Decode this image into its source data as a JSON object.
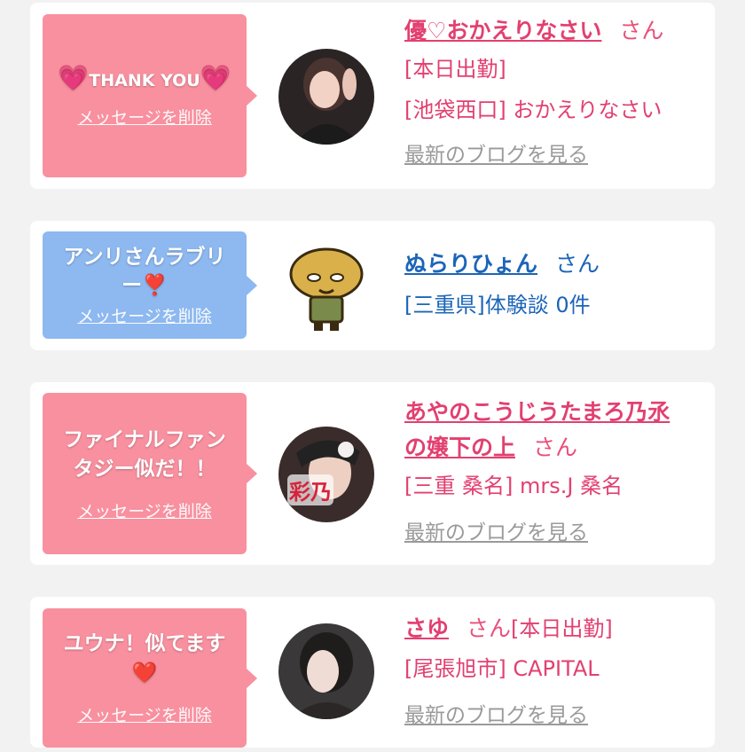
{
  "colors": {
    "pink_bubble": "#f8909f",
    "blue_bubble": "#8db8f0",
    "pink_text": "#e24070",
    "blue_text": "#1c65b8",
    "link_gray": "#9a9a9a"
  },
  "cards": [
    {
      "bubble": {
        "heart_left": "💗",
        "message": "THANK YOU",
        "heart_right": "💗",
        "delete": "メッセージを削除"
      },
      "name": "優♡おかえりなさい",
      "san": "さん",
      "line1": "[本日出勤]",
      "line2": "[池袋西口] おかえりなさい",
      "blog": "最新のブログを見る"
    },
    {
      "bubble": {
        "message_1": "アンリさんラブリ",
        "message_2": "ー❣️",
        "delete": "メッセージを削除"
      },
      "name": "ぬらりひょん",
      "san": "さん",
      "line1": "[三重県]体験談 0件"
    },
    {
      "bubble": {
        "message_1": "ファイナルファン",
        "message_2": "タジー似だ！！",
        "delete": "メッセージを削除"
      },
      "name_1": "あやのこうじうたまろ乃氶",
      "name_2": "の嬢下の上",
      "san": "さん",
      "avatar_text": "彩乃",
      "line1": "[三重 桑名] mrs.J 桑名",
      "blog": "最新のブログを見る"
    },
    {
      "bubble": {
        "message_1": "ユウナ！似てます",
        "message_2": "❤️",
        "delete": "メッセージを削除"
      },
      "name": "さゆ",
      "san": "さん",
      "line0_tail": "[本日出勤]",
      "line1": "[尾張旭市] CAPITAL",
      "blog": "最新のブログを見る"
    }
  ]
}
